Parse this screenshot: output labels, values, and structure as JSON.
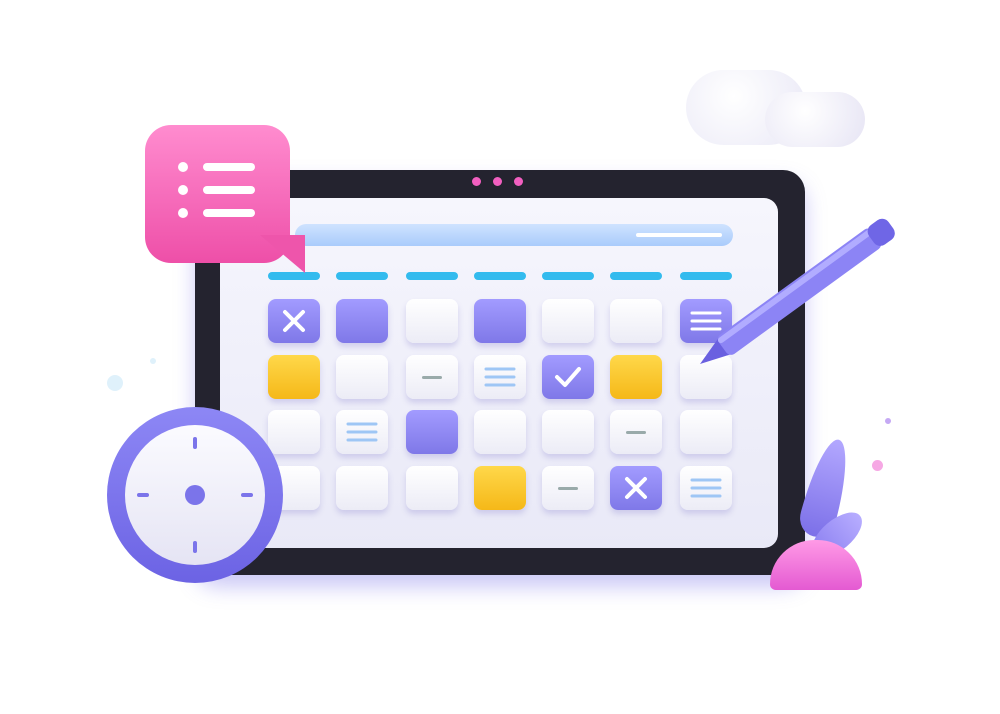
{
  "colors": {
    "frame": "#24232f",
    "accent_purple": "#8f88f5",
    "accent_yellow": "#fcc930",
    "accent_pink": "#f05aac",
    "header_dash": "#33bbee"
  },
  "calendar": {
    "columns": 7,
    "rows": [
      [
        "purple-x",
        "purple",
        "white",
        "purple",
        "white",
        "white",
        "purple-lines"
      ],
      [
        "yellow",
        "white",
        "white-dash",
        "white-lines",
        "purple-check",
        "yellow",
        "white"
      ],
      [
        "white",
        "white-lines",
        "purple",
        "white",
        "white",
        "white-dash",
        "white"
      ],
      [
        "white",
        "white",
        "white",
        "yellow",
        "white-dash",
        "purple-x",
        "white-lines"
      ]
    ]
  },
  "icons": [
    "chat-bubble-list-icon",
    "clock-icon",
    "pen-icon",
    "cloud-icon",
    "plant-icon"
  ]
}
